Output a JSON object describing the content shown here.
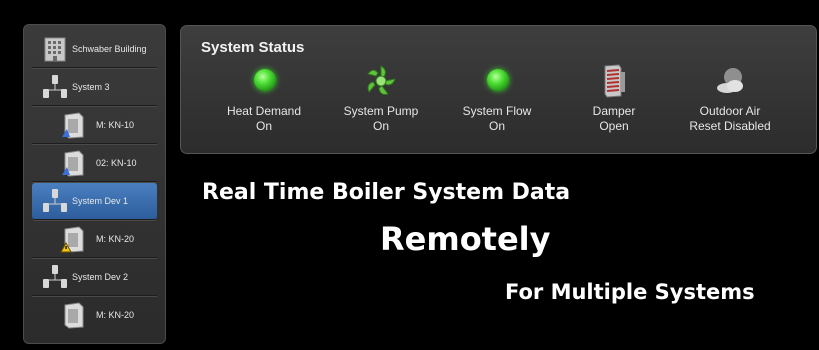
{
  "sidebar": {
    "items": [
      {
        "label": "Schwaber Building",
        "icon": "building-icon"
      },
      {
        "label": "System 3",
        "icon": "system-tree-icon"
      },
      {
        "label": "M: KN-10",
        "icon": "boiler-icon"
      },
      {
        "label": "02: KN-10",
        "icon": "boiler-icon"
      },
      {
        "label": "System Dev 1",
        "icon": "system-tree-icon"
      },
      {
        "label": "M: KN-20",
        "icon": "boiler-warning-icon"
      },
      {
        "label": "System Dev 2",
        "icon": "system-tree-icon"
      },
      {
        "label": "M: KN-20",
        "icon": "boiler-icon"
      }
    ],
    "selected_index": 4,
    "selected_color": "#3b6fb0"
  },
  "status": {
    "title": "System Status",
    "items": [
      {
        "line1": "Heat Demand",
        "line2": "On",
        "icon": "green-led-icon"
      },
      {
        "line1": "System Pump",
        "line2": "On",
        "icon": "pump-icon"
      },
      {
        "line1": "System Flow",
        "line2": "On",
        "icon": "green-led-icon"
      },
      {
        "line1": "Damper",
        "line2": "Open",
        "icon": "damper-icon"
      },
      {
        "line1": "Outdoor Air",
        "line2": "Reset Disabled",
        "icon": "outdoor-air-icon"
      }
    ]
  },
  "headlines": {
    "line1": "Real Time Boiler System Data",
    "line2": "Remotely",
    "line3": "For Multiple Systems"
  },
  "colors": {
    "led_green": "#4fe036",
    "pump_green": "#5fc43c",
    "damper_red": "#b03030"
  }
}
